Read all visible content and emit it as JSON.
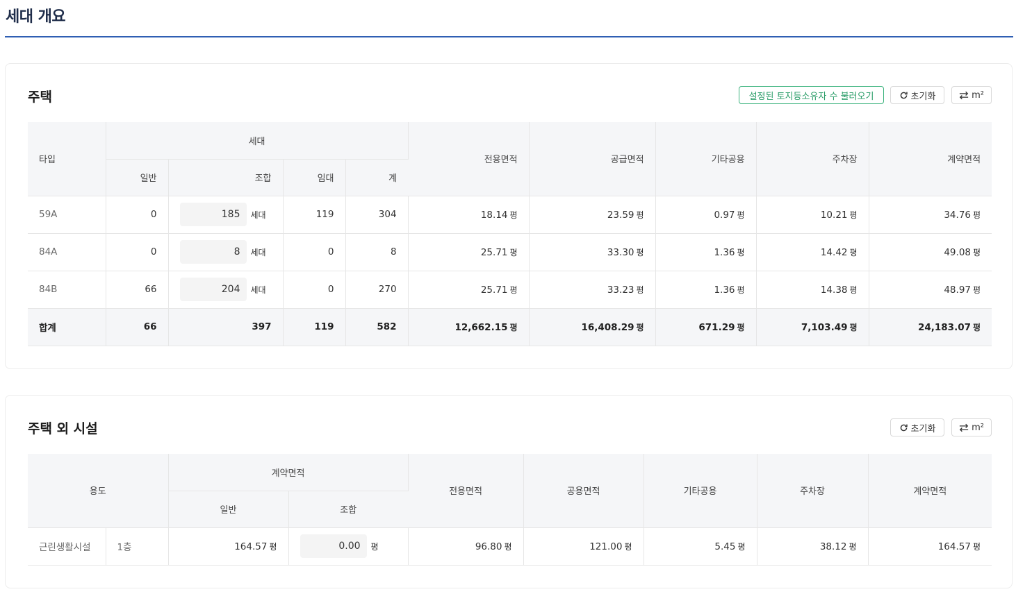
{
  "page": {
    "title": "세대 개요"
  },
  "housing": {
    "title": "주택",
    "buttons": {
      "load_owners": "설정된 토지등소유자 수 불러오기",
      "reset": "초기화",
      "unit": "m²"
    },
    "headers": {
      "type": "타입",
      "households": "세대",
      "general": "일반",
      "union": "조합",
      "rental": "임대",
      "total": "계",
      "exclusive": "전용면적",
      "supply": "공급면적",
      "other_common": "기타공용",
      "parking": "주차장",
      "contract": "계약면적"
    },
    "unit_household": "세대",
    "unit_area": "평",
    "rows": [
      {
        "type": "59A",
        "general": "0",
        "union": "185",
        "rental": "119",
        "total": "304",
        "exclusive": "18.14",
        "supply": "23.59",
        "other": "0.97",
        "parking": "10.21",
        "contract": "34.76"
      },
      {
        "type": "84A",
        "general": "0",
        "union": "8",
        "rental": "0",
        "total": "8",
        "exclusive": "25.71",
        "supply": "33.30",
        "other": "1.36",
        "parking": "14.42",
        "contract": "49.08"
      },
      {
        "type": "84B",
        "general": "66",
        "union": "204",
        "rental": "0",
        "total": "270",
        "exclusive": "25.71",
        "supply": "33.23",
        "other": "1.36",
        "parking": "14.38",
        "contract": "48.97"
      }
    ],
    "sum": {
      "label": "합계",
      "general": "66",
      "union": "397",
      "rental": "119",
      "total": "582",
      "exclusive": "12,662.15",
      "supply": "16,408.29",
      "other": "671.29",
      "parking": "7,103.49",
      "contract": "24,183.07"
    }
  },
  "facilities": {
    "title": "주택 외 시설",
    "buttons": {
      "reset": "초기화",
      "unit": "m²"
    },
    "headers": {
      "use": "용도",
      "contract_group": "계약면적",
      "general": "일반",
      "union": "조합",
      "exclusive": "전용면적",
      "common": "공용면적",
      "other_common": "기타공용",
      "parking": "주차장",
      "contract": "계약면적"
    },
    "unit_area": "평",
    "rows": [
      {
        "use": "근린생활시설",
        "floor": "1층",
        "general": "164.57",
        "union": "0.00",
        "exclusive": "96.80",
        "common": "121.00",
        "other": "5.45",
        "parking": "38.12",
        "contract": "164.57"
      }
    ]
  },
  "colors": {
    "accent": "#2f5fb3",
    "green": "#3bb37d",
    "header_bg": "#f5f6f8"
  }
}
